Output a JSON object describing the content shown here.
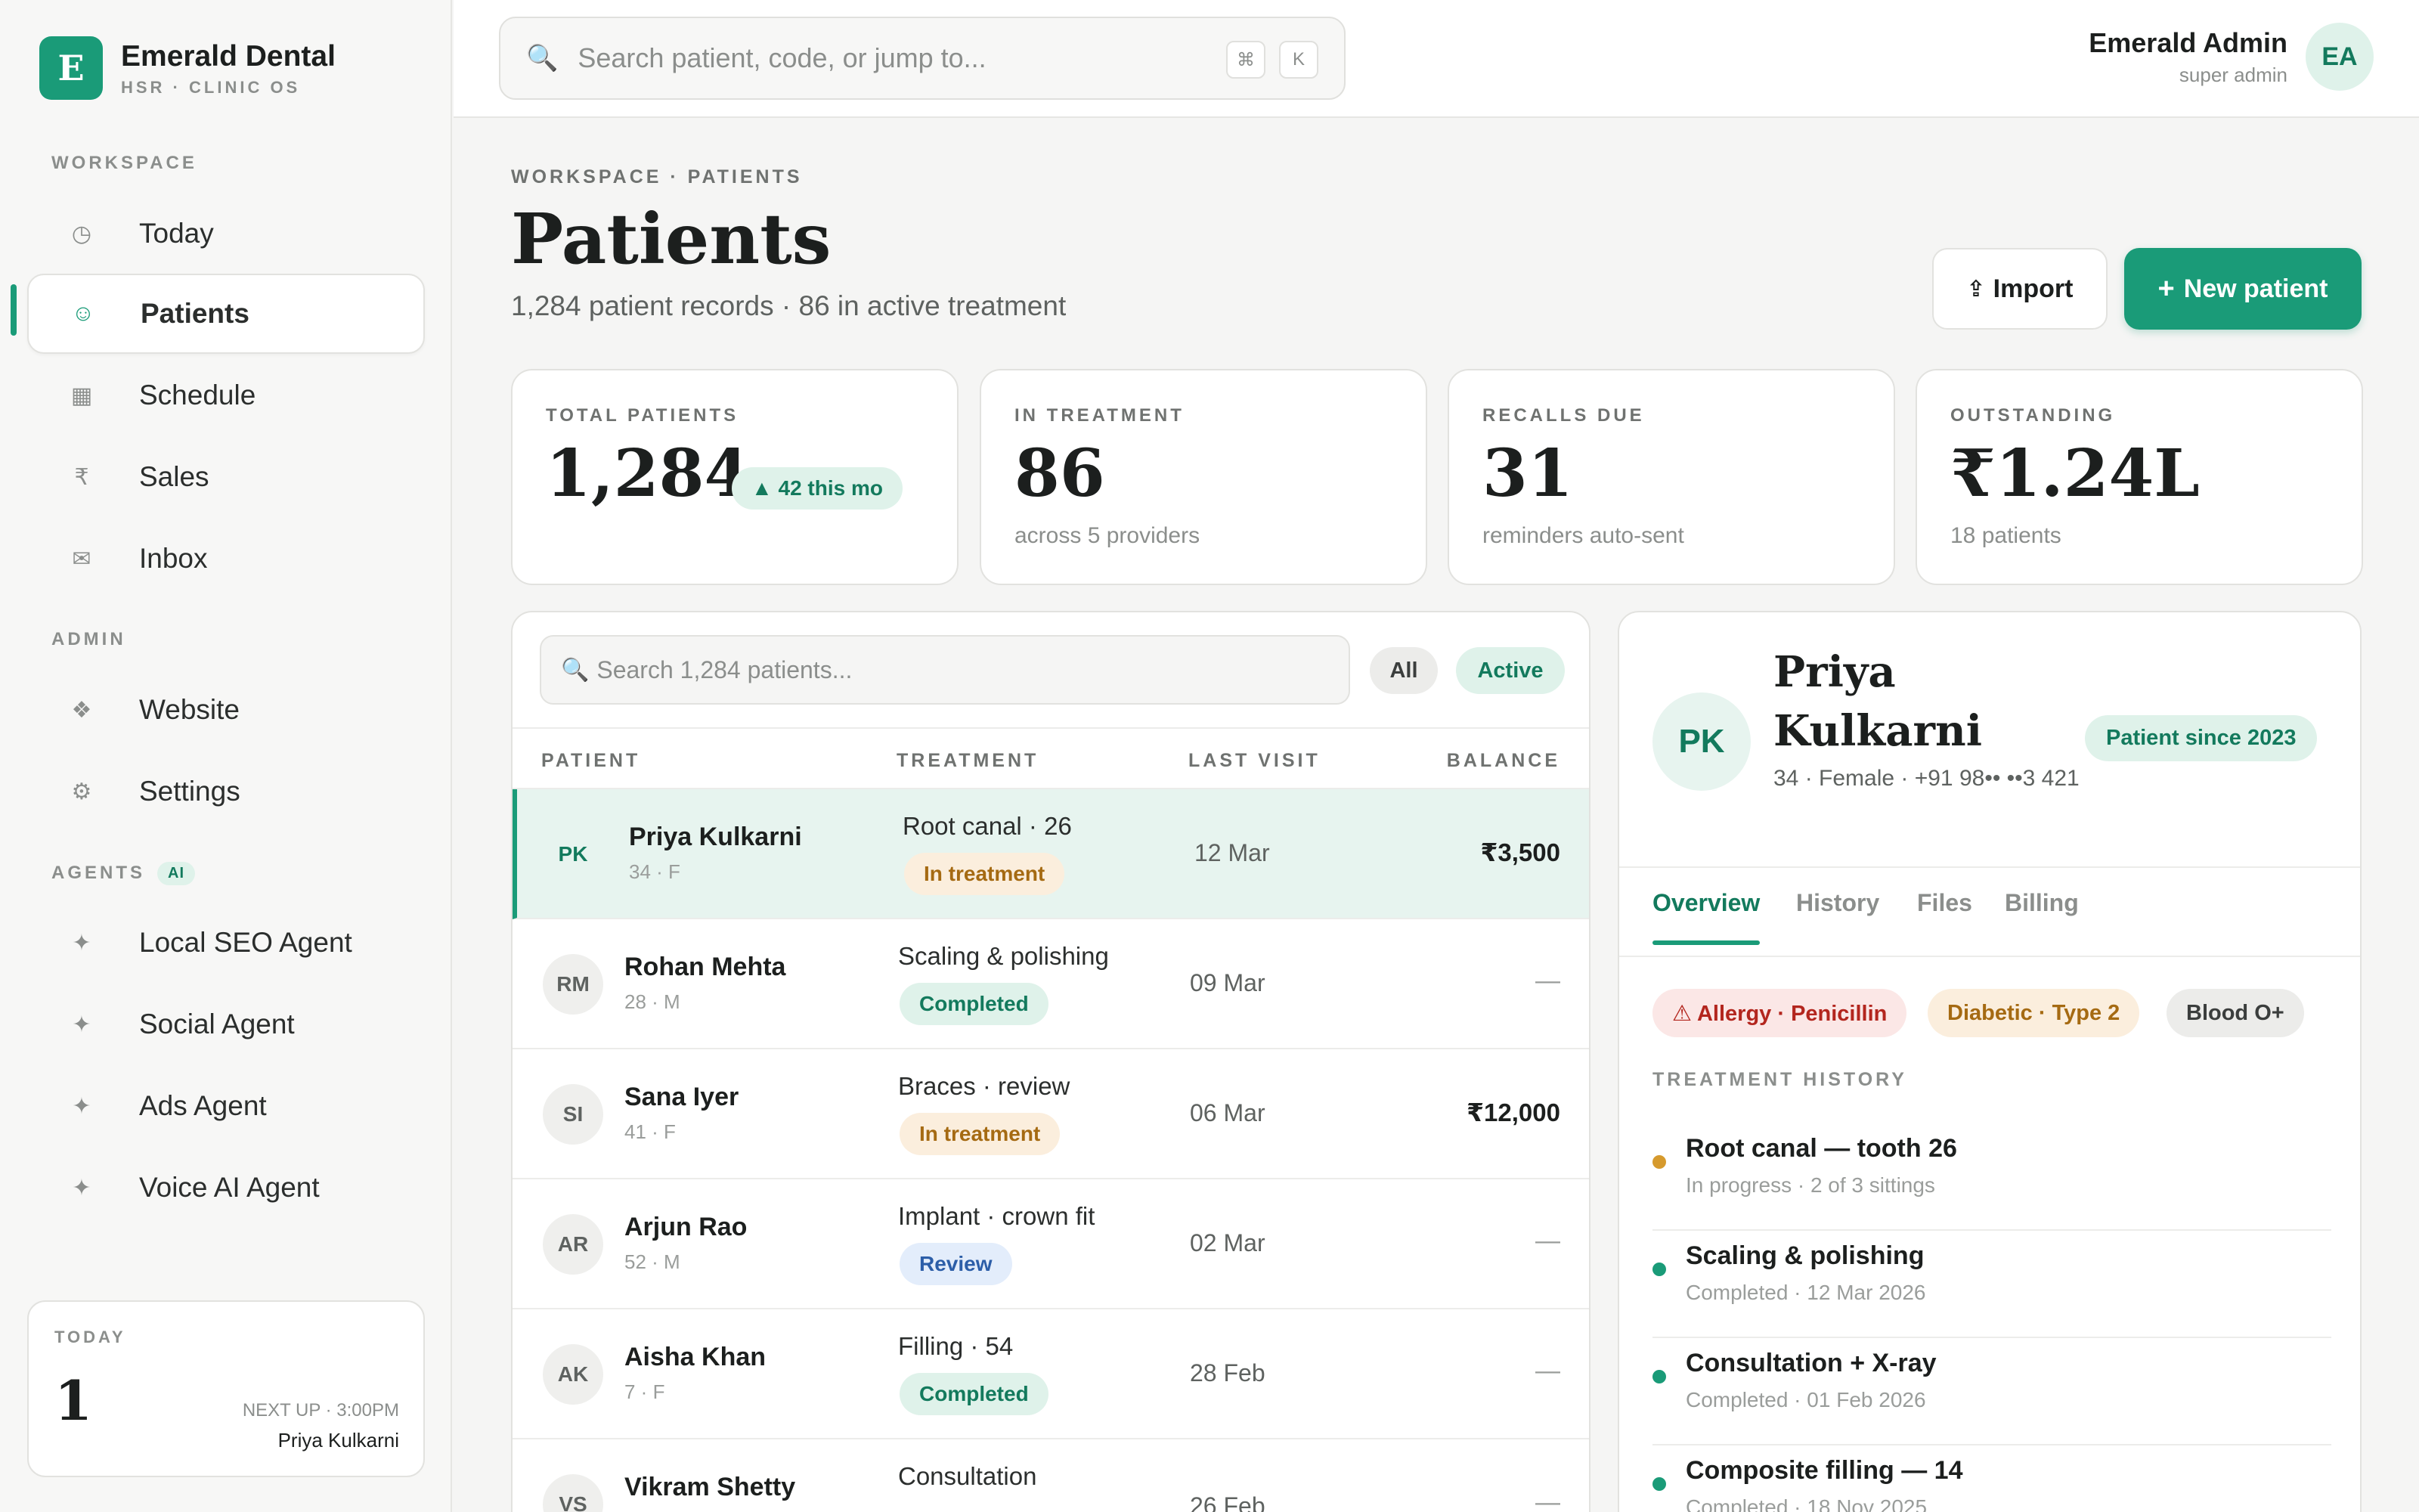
{
  "brand": {
    "logo_letter": "E",
    "name": "Emerald Dental",
    "sub": "HSR · CLINIC OS",
    "accent": "#1a9b78"
  },
  "sidebar": {
    "workspace_label": "WORKSPACE",
    "workspace_items": [
      {
        "label": "Today",
        "icon": "clock-icon"
      },
      {
        "label": "Patients",
        "icon": "smile-icon",
        "active": true
      },
      {
        "label": "Schedule",
        "icon": "calendar-icon"
      },
      {
        "label": "Sales",
        "icon": "rupee-icon"
      },
      {
        "label": "Inbox",
        "icon": "mail-icon"
      }
    ],
    "admin_label": "ADMIN",
    "admin_items": [
      {
        "label": "Website",
        "icon": "diamond-icon"
      },
      {
        "label": "Settings",
        "icon": "gear-icon"
      }
    ],
    "agents_label": "AGENTS",
    "agents_badge": "AI",
    "agent_items": [
      {
        "label": "Local SEO Agent",
        "icon": "sparkle-icon"
      },
      {
        "label": "Social Agent",
        "icon": "sparkle-icon"
      },
      {
        "label": "Ads Agent",
        "icon": "sparkle-icon"
      },
      {
        "label": "Voice AI Agent",
        "icon": "sparkle-icon"
      }
    ],
    "today_card": {
      "label": "TODAY",
      "count": "1",
      "next_label": "NEXT UP · 3:00PM",
      "next_name": "Priya Kulkarni"
    }
  },
  "header": {
    "search_placeholder": "Search patient, code, or jump to...",
    "kbd": [
      "⌘",
      "K"
    ],
    "user_name": "Emerald Admin",
    "user_role": "super admin",
    "user_initials": "EA"
  },
  "page": {
    "breadcrumb": "WORKSPACE · PATIENTS",
    "title": "Patients",
    "subtitle": "1,284 patient records · 86 in active treatment",
    "import_label": "Import",
    "new_label": "New patient"
  },
  "stats": [
    {
      "label": "TOTAL PATIENTS",
      "value": "1,284",
      "pill": "▲ 42 this mo",
      "sub": ""
    },
    {
      "label": "IN TREATMENT",
      "value": "86",
      "sub": "across 5 providers"
    },
    {
      "label": "RECALLS DUE",
      "value": "31",
      "sub": "reminders auto-sent"
    },
    {
      "label": "OUTSTANDING",
      "value": "₹1.24L",
      "sub": "18 patients"
    }
  ],
  "table": {
    "search_placeholder": "Search 1,284 patients...",
    "filters": [
      "All",
      "Active"
    ],
    "columns": [
      "PATIENT",
      "TREATMENT",
      "LAST VISIT",
      "BALANCE"
    ],
    "rows": [
      {
        "initials": "PK",
        "name": "Priya Kulkarni",
        "meta": "34 · F",
        "treatment": "Root canal · 26",
        "status": "In treatment",
        "visit": "12 Mar",
        "balance": "₹3,500"
      },
      {
        "initials": "RM",
        "name": "Rohan Mehta",
        "meta": "28 · M",
        "treatment": "Scaling & polishing",
        "status": "Completed",
        "visit": "09 Mar",
        "balance": "—"
      },
      {
        "initials": "SI",
        "name": "Sana Iyer",
        "meta": "41 · F",
        "treatment": "Braces · review",
        "status": "In treatment",
        "visit": "06 Mar",
        "balance": "₹12,000"
      },
      {
        "initials": "AR",
        "name": "Arjun Rao",
        "meta": "52 · M",
        "treatment": "Implant · crown fit",
        "status": "Review",
        "visit": "02 Mar",
        "balance": "—"
      },
      {
        "initials": "AK",
        "name": "Aisha Khan",
        "meta": "7 · F",
        "treatment": "Filling · 54",
        "status": "Completed",
        "visit": "28 Feb",
        "balance": "—"
      },
      {
        "initials": "VS",
        "name": "Vikram Shetty",
        "meta": "",
        "treatment": "Consultation",
        "status": "",
        "visit": "26 Feb",
        "balance": "—"
      }
    ]
  },
  "detail": {
    "initials": "PK",
    "name": "Priya Kulkarni",
    "meta": "34 · Female · +91 98•• ••3 421",
    "since": "Patient since 2023",
    "tabs": [
      "Overview",
      "History",
      "Files",
      "Billing"
    ],
    "tags": [
      "⚠ Allergy · Penicillin",
      "Diabetic · Type 2",
      "Blood O+"
    ],
    "history_label": "TREATMENT HISTORY",
    "history": [
      {
        "title": "Root canal — tooth 26",
        "sub": "In progress · 2 of 3 sittings",
        "color": "#d69a2d"
      },
      {
        "title": "Scaling & polishing",
        "sub": "Completed · 12 Mar 2026",
        "color": "#1a9b78"
      },
      {
        "title": "Consultation + X-ray",
        "sub": "Completed · 01 Feb 2026",
        "color": "#1a9b78"
      },
      {
        "title": "Composite filling — 14",
        "sub": "Completed · 18 Nov 2025",
        "color": "#1a9b78"
      }
    ]
  }
}
